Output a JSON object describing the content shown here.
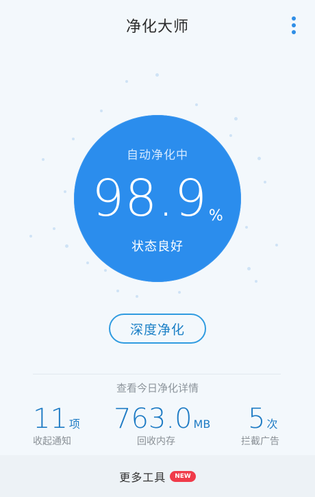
{
  "header": {
    "title": "净化大师",
    "menu_icon": "more-vertical-icon",
    "accent_color": "#2f8ee6"
  },
  "gauge": {
    "status_top": "自动净化中",
    "score": "98.9",
    "unit": "%",
    "status_bottom": "状态良好",
    "circle_color": "#2b8ded"
  },
  "deep_clean": {
    "label": "深度净化"
  },
  "details": {
    "link_text": "查看今日净化详情"
  },
  "stats": [
    {
      "value": "11",
      "suffix": "项",
      "label": "收起通知"
    },
    {
      "value": "763.0",
      "suffix": "MB",
      "label": "回收内存"
    },
    {
      "value": "5",
      "suffix": "次",
      "label": "拦截广告"
    }
  ],
  "bottom_bar": {
    "label": "更多工具",
    "badge": "NEW",
    "badge_color": "#f03b4a"
  }
}
